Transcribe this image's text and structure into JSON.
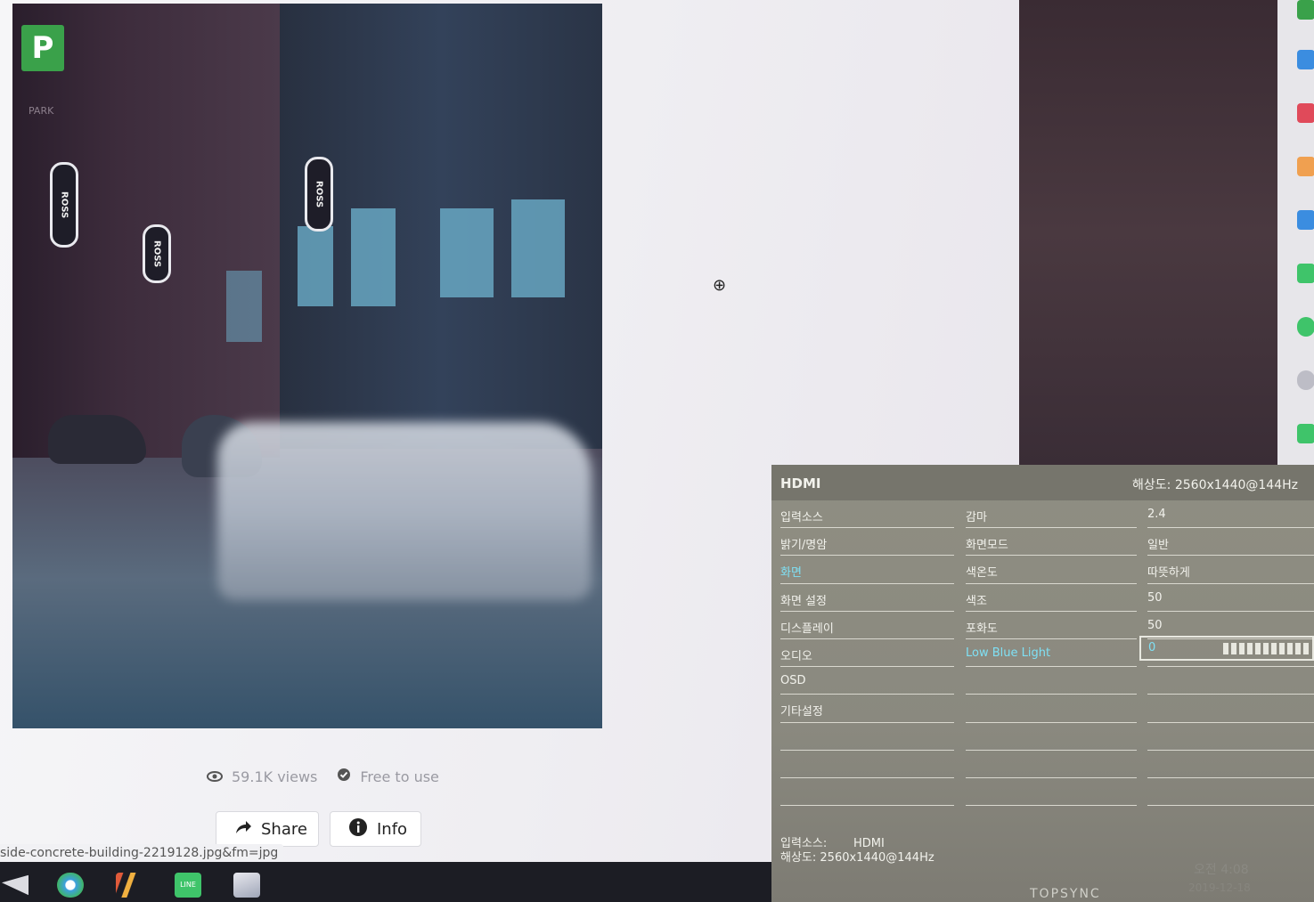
{
  "photo": {
    "logo_text": "P",
    "signs": [
      "ROSS",
      "ROSS",
      "ROSS"
    ],
    "store_sign": "PARK"
  },
  "meta": {
    "views": "59.1K views",
    "license": "Free to use"
  },
  "buttons": {
    "share": "Share",
    "info": "Info"
  },
  "status_url": "side-concrete-building-2219128.jpg&fm=jpg",
  "osd": {
    "input": "HDMI",
    "resolution_header": "해상도: 2560x1440@144Hz",
    "menu": [
      "입력소스",
      "밝기/명암",
      "화면",
      "화면 설정",
      "디스플레이",
      "오디오",
      "OSD",
      "기타설정"
    ],
    "active_menu_index": 2,
    "settings": [
      {
        "label": "감마",
        "value": "2.4"
      },
      {
        "label": "화면모드",
        "value": "일반"
      },
      {
        "label": "색온도",
        "value": "따뜻하게"
      },
      {
        "label": "색조",
        "value": "50"
      },
      {
        "label": "포화도",
        "value": "50"
      },
      {
        "label": "Low Blue Light",
        "value": "0"
      }
    ],
    "low_blue_light_level": 0,
    "footer": {
      "input_label": "입력소스:",
      "input_value": "HDMI",
      "resolution_label": "해상도:",
      "resolution_value": "2560x1440@144Hz"
    }
  },
  "monitor_brand": "TOPSYNC",
  "clock": {
    "time": "오전 4:08",
    "date": "2019-12-18"
  },
  "colors": {
    "osd_accent": "#7fe0f4",
    "osd_bg": "#8a897f",
    "logo_green": "#3aa14a"
  }
}
